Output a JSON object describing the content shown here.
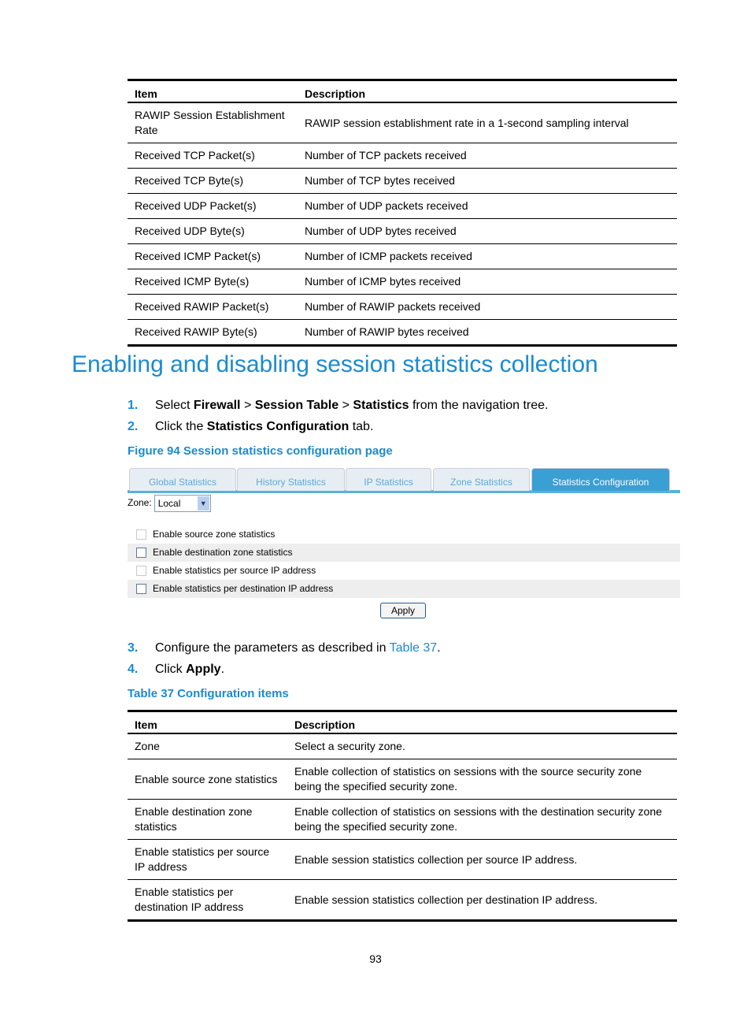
{
  "table1": {
    "headers": [
      "Item",
      "Description"
    ],
    "rows": [
      [
        "RAWIP Session Establishment Rate",
        "RAWIP session establishment rate in a 1-second sampling interval"
      ],
      [
        "Received TCP Packet(s)",
        "Number of TCP packets received"
      ],
      [
        "Received TCP Byte(s)",
        "Number of TCP bytes received"
      ],
      [
        "Received UDP Packet(s)",
        "Number of UDP packets received"
      ],
      [
        "Received UDP Byte(s)",
        "Number of UDP bytes received"
      ],
      [
        "Received ICMP Packet(s)",
        "Number of ICMP packets received"
      ],
      [
        "Received ICMP Byte(s)",
        "Number of ICMP bytes received"
      ],
      [
        "Received RAWIP Packet(s)",
        "Number of RAWIP packets received"
      ],
      [
        "Received RAWIP Byte(s)",
        "Number of RAWIP bytes received"
      ]
    ]
  },
  "heading": "Enabling and disabling session statistics collection",
  "steps": {
    "s1": {
      "n": "1.",
      "a": "Select ",
      "b1": "Firewall",
      "c": " > ",
      "b2": "Session Table",
      "d": " > ",
      "b3": "Statistics",
      "e": " from the navigation tree."
    },
    "s2": {
      "n": "2.",
      "a": "Click the ",
      "b": "Statistics Configuration",
      "c": " tab."
    },
    "s3": {
      "n": "3.",
      "a": "Configure the parameters as described in ",
      "link": "Table 37",
      "c": "."
    },
    "s4": {
      "n": "4.",
      "a": "Click ",
      "b": "Apply",
      "c": "."
    }
  },
  "figure_caption": "Figure 94 Session statistics configuration page",
  "figure": {
    "tabs": [
      "Global Statistics",
      "History Statistics",
      "IP Statistics",
      "Zone Statistics",
      "Statistics Configuration"
    ],
    "active_tab": "Statistics Configuration",
    "zone_label": "Zone:",
    "zone_value": "Local",
    "checkboxes": [
      {
        "label": "Enable source zone statistics",
        "checked": false
      },
      {
        "label": "Enable destination zone statistics",
        "checked": false
      },
      {
        "label": "Enable statistics per source IP address",
        "checked": false
      },
      {
        "label": "Enable statistics per destination IP address",
        "checked": false
      }
    ],
    "apply": "Apply"
  },
  "table2_caption": "Table 37 Configuration items",
  "table2": {
    "headers": [
      "Item",
      "Description"
    ],
    "rows": [
      [
        "Zone",
        "Select a security zone."
      ],
      [
        "Enable source zone statistics",
        "Enable collection of statistics on sessions with the source security zone being the specified security zone."
      ],
      [
        "Enable destination zone statistics",
        "Enable collection of statistics on sessions with the destination security zone being the specified security zone."
      ],
      [
        "Enable statistics per source IP address",
        "Enable session statistics collection per source IP address."
      ],
      [
        "Enable statistics per destination IP address",
        "Enable session statistics collection per destination IP address."
      ]
    ]
  },
  "page_number": "93"
}
